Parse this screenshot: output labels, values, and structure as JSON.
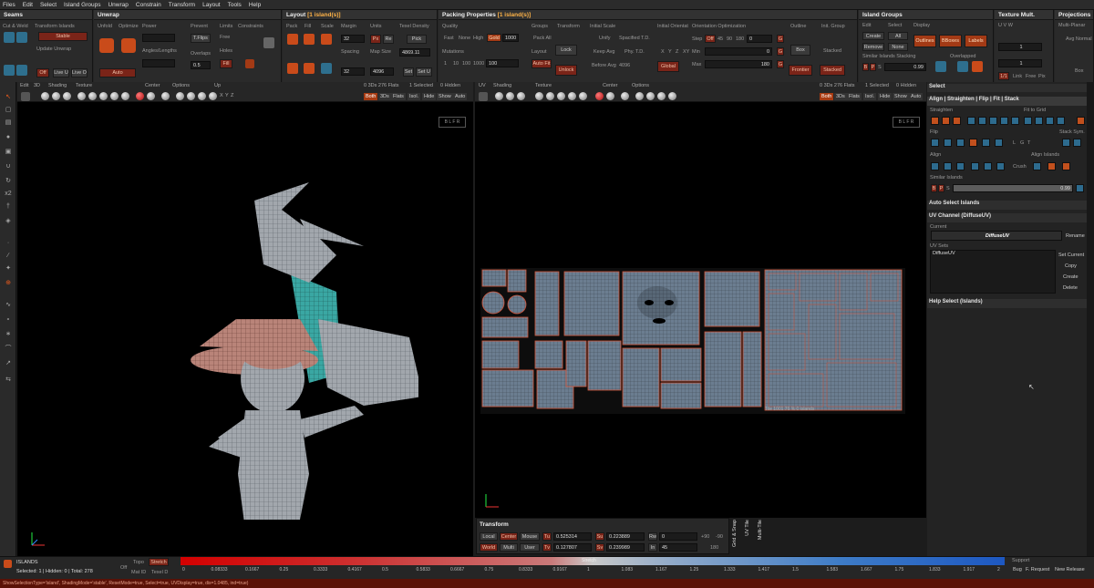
{
  "menu": [
    "Files",
    "Edit",
    "Select",
    "Island Groups",
    "Unwrap",
    "Constrain",
    "Transform",
    "Layout",
    "Tools",
    "Help"
  ],
  "panels": {
    "seams": {
      "title": "Seams",
      "cut_weld": "Cut & Weld",
      "transform_islands": "Transform Islands",
      "stable": "Stable",
      "update_unwrap": "Update Unwrap",
      "off": "Off",
      "live_u": "Live U",
      "live_o": "Live O"
    },
    "unwrap": {
      "title": "Unwrap",
      "unfold": "Unfold",
      "optimize": "Optimize",
      "power": "Power",
      "prevent": "Prevent",
      "limits": "Limits",
      "constraints": "Constraints",
      "tflips": "T.Flips",
      "angles_lengths": "Angles/Lengths",
      "overlaps": "Overlaps",
      "overlaps_val": "0.5",
      "free": "Free",
      "holes": "Holes",
      "fill": "Fill",
      "auto": "Auto"
    },
    "layout": {
      "title": "Layout",
      "title_hl": "[1 island(s)]",
      "pack": "Pack",
      "fill": "Fill",
      "scale": "Scale",
      "margin": "Margin",
      "units": "Units",
      "texel_density": "Texel Density",
      "margin_val": "32",
      "px": "Px",
      "re": "Re",
      "pick": "Pick",
      "spacing": "Spacing",
      "map_size": "Map Size",
      "spacing_val": "32",
      "map_val": "4096",
      "density_val": "4869.11",
      "set": "Set",
      "set_u": "Set U"
    },
    "packing": {
      "title": "Packing Properties",
      "title_hl": "[1 island(s)]",
      "quality": "Quality",
      "fast": "Fast",
      "none": "None",
      "high": "High",
      "gold": "Gold",
      "q_val": "1000",
      "groups": "Groups",
      "pack_all": "Pack All",
      "transform": "Transform",
      "lock": "Lock",
      "mutations": "Mutations",
      "m_vals": [
        "1",
        "10",
        "100",
        "1000",
        "100"
      ],
      "layout": "Layout",
      "auto_fit": "Auto Fit",
      "unlock": "Unlock",
      "initial_scale": "Initial Scale",
      "unify": "Unify",
      "spacified_td": "Spacified T.D.",
      "keep_avg": "Keep Avg",
      "phy_td": "Phy. T.D.",
      "before_avg": "Before Avg",
      "before_val": "4096",
      "initial_orient": "Initial Orientat",
      "x": "X",
      "y": "Y",
      "z": "Z",
      "xy": "XY",
      "global": "Global",
      "orient_opt": "Orientation Optimization",
      "step": "Step",
      "step_off": "Off",
      "step_vals": [
        "45",
        "90",
        "180",
        "0"
      ],
      "min": "Min",
      "min_val": "0",
      "max": "Max",
      "max_val": "180",
      "outline": "Outline",
      "box": "Box",
      "frontier": "Frontier",
      "init_group": "Init. Group",
      "stacked": "Stacked",
      "stacked2": "Stacked"
    },
    "islands": {
      "title": "Island Groups",
      "edit": "Edit",
      "select": "Select",
      "display": "Display",
      "create": "Create",
      "all": "All",
      "remove": "Remove",
      "none": "None",
      "outlines": "Outlines",
      "bboxes": "BBoxes",
      "labels": "Labels",
      "similar": "Similar Islands Stacking",
      "overlapped": "Overlapped",
      "b": "B",
      "p": "P",
      "s": "S",
      "sim_val": "0.99"
    },
    "texture": {
      "title": "Texture Mult.",
      "uvw": "U V W",
      "u_val": "1",
      "v_val": "1",
      "one": "1/1",
      "link": "Link",
      "free": "Free",
      "pix": "Pix"
    },
    "projections": {
      "title": "Projections",
      "multi_planar": "Multi-Planar",
      "avg_normal": "Avg Normal",
      "box": "Box"
    }
  },
  "viewport3d": {
    "edit": "Edit",
    "three_d": "3D",
    "shading": "Shading",
    "texture": "Texture",
    "center": "Center",
    "options": "Options",
    "up": "Up",
    "axes": [
      "X",
      "Y",
      "Z"
    ],
    "stats": "0 3Ds 276 Flats",
    "selected": "1 Selected",
    "hidden": "0 Hidden",
    "modes": [
      "Both",
      "3Ds",
      "Flats",
      "Isol.",
      "Hide",
      "Show",
      "Auto"
    ],
    "cube": "B L F R"
  },
  "viewportuv": {
    "uv": "UV",
    "shading": "Shading",
    "texture": "Texture",
    "center": "Center",
    "options": "Options",
    "stats": "0 3Ds 276 Flats",
    "selected": "1 Selected",
    "hidden": "0 Hidden",
    "modes": [
      "Both",
      "3Ds",
      "Flats",
      "Isol.",
      "Hide",
      "Show",
      "Auto"
    ],
    "tile_label": "Tile 1001 76 %   0   islands",
    "cube": "B L F R"
  },
  "transform": {
    "title": "Transform",
    "local": "Local",
    "center": "Center",
    "mouse": "Mouse",
    "world": "World",
    "multi": "Multi",
    "user": "User",
    "tu_lbl": "Tu",
    "tu": "0.525314",
    "tv_lbl": "Tv",
    "tv": "0.127807",
    "su_lbl": "Su",
    "su": "0.223889",
    "sv_lbl": "Sv",
    "sv": "0.239989",
    "rw_lbl": "Rw",
    "rw": "0",
    "in_lbl": "In",
    "in": "45",
    "p90": "+90",
    "m90": "-90",
    "v180": "180",
    "grid_snap": "Grid & Snap",
    "uv_tile": "UV Tile",
    "multi_tile": "Multi-Tile"
  },
  "rightpanel": {
    "select": "Select",
    "align_title": "Align | Straighten | Flip | Fit | Stack",
    "straighten": "Straighten",
    "fit_to_grid": "Fit to Grid",
    "flip": "Flip",
    "stack_sym": "Stack Sym.",
    "l": "L",
    "g": "G",
    "t": "T",
    "align": "Align",
    "crush": "Crush",
    "align_islands": "Align Islands",
    "similar": "Similar Islands",
    "b": "B",
    "p": "P",
    "s": "S",
    "sim_val": "0.99",
    "auto_select": "Auto Select Islands",
    "uv_channel": "UV Channel (DiffuseUV)",
    "current": "Current",
    "diffuse": "DiffuseUV",
    "rename": "Rename",
    "uv_sets": "UV Sets",
    "set_item": "DiffuseUV",
    "set_current": "Set Current",
    "copy": "Copy",
    "create": "Create",
    "delete": "Delete",
    "help": "Help Select (Islands)"
  },
  "status": {
    "islands": "ISLANDS",
    "selected": "Selected: 1 | Hidden: 0 | Total: 278",
    "off": "Off",
    "topo": "Topo",
    "stretch": "Stretch",
    "mat_id": "Mat ID",
    "texel": "Texel D",
    "stretch_label": "Stretch",
    "ticks": [
      "0",
      "0.08333",
      "0.1667",
      "0.25",
      "0.3333",
      "0.4167",
      "0.5",
      "0.5833",
      "0.6667",
      "0.75",
      "0.8333",
      "0.9167",
      "1",
      "1.083",
      "1.167",
      "1.25",
      "1.333",
      "1.417",
      "1.5",
      "1.583",
      "1.667",
      "1.75",
      "1.833",
      "1.917",
      "2"
    ],
    "support": "Support",
    "bug": "Bug",
    "f_request": "F. Request",
    "new_release": "New Release"
  },
  "footer": "ShowSelectionType='island', ShadingMode='stable', ResetMode=true, Select=true, UVDisplay=true, dis=1.0485, ind=true)"
}
